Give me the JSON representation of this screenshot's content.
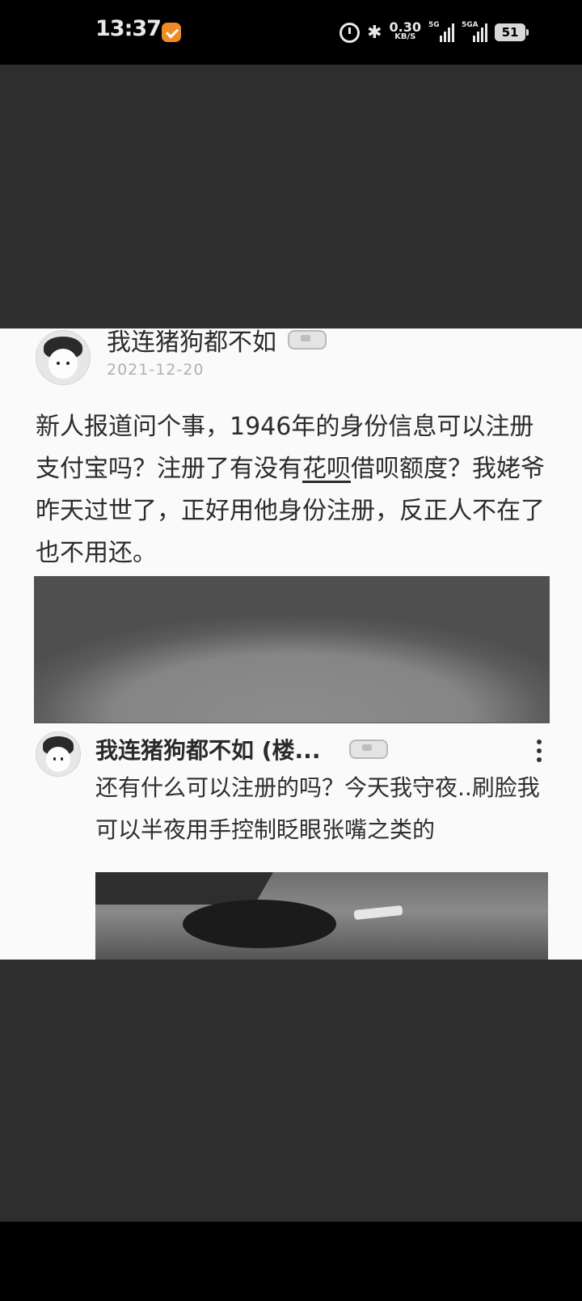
{
  "status_bar": {
    "time": "13:37",
    "net_speed_value": "0.30",
    "net_speed_unit": "KB/S",
    "signal1_tag": "5G",
    "signal2_tag": "5GA",
    "battery": "51"
  },
  "post": {
    "username": "我连猪狗都不如",
    "date": "2021-12-20",
    "text_before": "新人报道问个事，1946年的身份信息可以注册支付宝吗？注册了有没有",
    "text_link": "花呗",
    "text_after": "借呗额度？我姥爷昨天过世了，正好用他身份注册，反正人不在了也不用还。"
  },
  "reply": {
    "username": "我连猪狗都不如 (楼...",
    "text": "还有什么可以注册的吗？今天我守夜..刷脸我可以半夜用手控制眨眼张嘴之类的"
  }
}
